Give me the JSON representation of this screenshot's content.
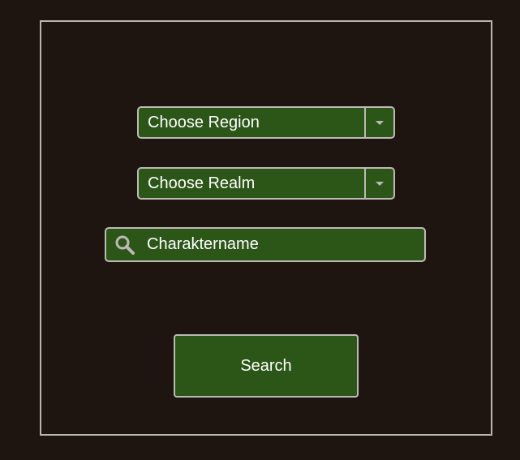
{
  "form": {
    "region_select": {
      "label": "Choose Region",
      "icon": "chevron-down-icon"
    },
    "realm_select": {
      "label": "Choose Realm",
      "icon": "chevron-down-icon"
    },
    "character_search": {
      "placeholder": "Charaktername",
      "value": "",
      "icon": "search-icon"
    },
    "search_button_label": "Search"
  },
  "colors": {
    "background": "#1e1511",
    "panel_border": "#b9b5b1",
    "control_fill": "#2c5618",
    "control_border": "#bdbab6",
    "text": "#ffffff"
  }
}
